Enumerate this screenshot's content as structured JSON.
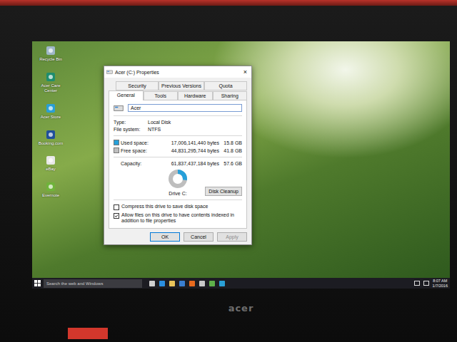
{
  "desktop_icons": [
    {
      "label": "Recycle Bin"
    },
    {
      "label": "Acer Care Center"
    },
    {
      "label": "Acer Store"
    },
    {
      "label": "Booking.com"
    },
    {
      "label": "eBay"
    },
    {
      "label": "Evernote"
    }
  ],
  "window": {
    "title": "Acer (C:) Properties",
    "close": "×"
  },
  "tab_rows": [
    [
      {
        "label": "Security",
        "selected": false
      },
      {
        "label": "Previous Versions",
        "selected": false
      },
      {
        "label": "Quota",
        "selected": false
      }
    ],
    [
      {
        "label": "General",
        "selected": true
      },
      {
        "label": "Tools",
        "selected": false
      },
      {
        "label": "Hardware",
        "selected": false
      },
      {
        "label": "Sharing",
        "selected": false
      }
    ]
  ],
  "name_field": {
    "value": "Acer"
  },
  "info": [
    {
      "label": "Type:",
      "value": "Local Disk"
    },
    {
      "label": "File system:",
      "value": "NTFS"
    }
  ],
  "space": [
    {
      "label": "Used space:",
      "bytes": "17,006,141,440 bytes",
      "size": "15.8 GB",
      "color": "#26a0da"
    },
    {
      "label": "Free space:",
      "bytes": "44,831,295,744 bytes",
      "size": "41.8 GB",
      "color": "#bebebe"
    }
  ],
  "capacity": {
    "label": "Capacity:",
    "bytes": "61,837,437,184 bytes",
    "size": "57.6 GB"
  },
  "drive": {
    "label": "Drive C:",
    "level": 0.275
  },
  "cleanup_button": "Disk Cleanup",
  "options": [
    {
      "label": "Compress this drive to save disk space",
      "checked": false
    },
    {
      "label": "Allow files on this drive to have contents indexed in addition to file properties",
      "checked": true
    }
  ],
  "buttons": [
    {
      "label": "OK",
      "disabled": false
    },
    {
      "label": "Cancel",
      "disabled": false
    },
    {
      "label": "Apply",
      "disabled": true
    }
  ],
  "taskbar": {
    "search_placeholder": "Search the web and Windows",
    "time": "8:07 AM",
    "date": "1/7/2016"
  },
  "bezel": {
    "brand": "acer"
  }
}
